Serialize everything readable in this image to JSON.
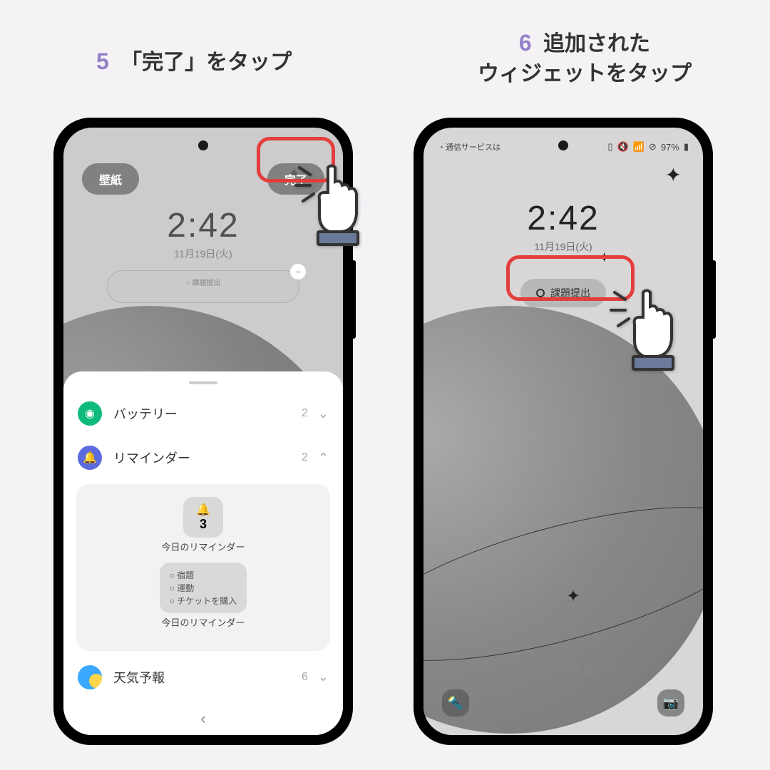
{
  "captions": {
    "step5_num": "5",
    "step5_text": "「完了」をタップ",
    "step6_num": "6",
    "step6_text": "追加された\nウィジェットをタップ"
  },
  "left": {
    "wallpaper_btn": "壁紙",
    "done_btn": "完了",
    "clock": "2:42",
    "date": "11月19日(火)",
    "mini_widget": "○ 課題提出",
    "sheet": {
      "battery": {
        "name": "バッテリー",
        "count": "2"
      },
      "reminder": {
        "name": "リマインダー",
        "count": "2"
      },
      "preview_num": "3",
      "preview_label": "今日のリマインダー",
      "tasks": [
        "○ 宿題",
        "○ 運動",
        "○ チケットを購入"
      ],
      "preview_label2": "今日のリマインダー",
      "weather": {
        "name": "天気予報",
        "count": "6"
      }
    }
  },
  "right": {
    "status_left": "・通信サービスは",
    "status_right": {
      "battery": "97%"
    },
    "clock": "2:42",
    "date": "11月19日(火)",
    "widget_text": "課題提出",
    "swipe": "スワイプしてください"
  }
}
